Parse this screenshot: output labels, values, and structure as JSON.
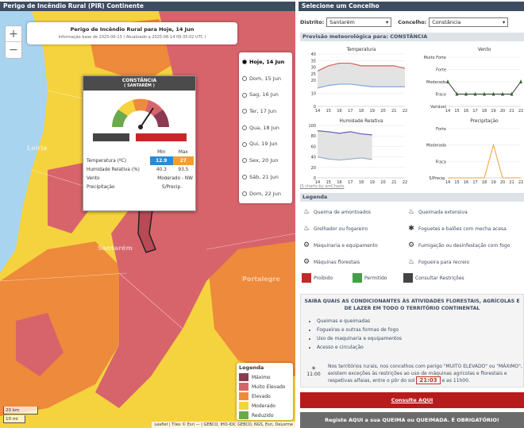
{
  "map_header": "Perigo de Incêndio Rural (PIR) Continente",
  "right_header": "Selecione um Concelho",
  "map": {
    "zoom_in": "+",
    "zoom_out": "−",
    "title": "Perigo de Incêndio Rural para Hoje, 14 Jun",
    "subtitle": "Informação base de 2025-06-13 ( Atualizado a 2025-06-14 09:35:02 UTC )",
    "place_labels": [
      "Leiria",
      "Santarém",
      "Portalegre"
    ],
    "days": [
      {
        "label": "Hoje, 14 Jun",
        "selected": true
      },
      {
        "label": "Dom, 15 Jun",
        "selected": false
      },
      {
        "label": "Sag, 16 Jun",
        "selected": false
      },
      {
        "label": "Ter, 17 Jun",
        "selected": false
      },
      {
        "label": "Qua, 18 Jun",
        "selected": false
      },
      {
        "label": "Qui, 19 Jun",
        "selected": false
      },
      {
        "label": "Sex, 20 Jun",
        "selected": false
      },
      {
        "label": "Sáb, 21 Jun",
        "selected": false
      },
      {
        "label": "Dom, 22 Jun",
        "selected": false
      }
    ],
    "legend_title": "Legenda",
    "legend": [
      {
        "label": "Máximo",
        "color": "#8b3a52"
      },
      {
        "label": "Muito Elevado",
        "color": "#d8646b"
      },
      {
        "label": "Elevado",
        "color": "#ee8a3c"
      },
      {
        "label": "Moderado",
        "color": "#f5d33e"
      },
      {
        "label": "Reduzido",
        "color": "#6aaa4c"
      }
    ],
    "scale_km": "20 km",
    "scale_mi": "10 mi",
    "attribution": "Leaflet | Tiles © Esri — | GEBCO, IHO-IOC GEBCO, NGS, Esri, DeLorme"
  },
  "popup": {
    "name": "CONSTÂNCIA",
    "district": "( SANTARÉM )",
    "col_min": "Min",
    "col_max": "Max",
    "temp_label": "Temperatura (ºC)",
    "temp_min": "12.9",
    "temp_max": "27",
    "hum_label": "Humidade Relativa (%)",
    "hum_min": "40.3",
    "hum_max": "93.5",
    "wind_label": "Vento",
    "wind_value": "Moderado - NW",
    "precip_label": "Precipitação",
    "precip_value": "S/Precip."
  },
  "selectors": {
    "district_label": "Distrito:",
    "district_value": "Santarém",
    "council_label": "Concelho:",
    "council_value": "Constância"
  },
  "forecast_title": "Previsão meteorológica para: CONSTÂNCIA",
  "charts_credit": "JS charts by amCharts",
  "chart_data": [
    {
      "type": "area",
      "title": "Temperatura",
      "x": [
        14,
        15,
        16,
        17,
        18,
        19,
        20,
        21,
        22
      ],
      "ylim": [
        0,
        40
      ],
      "yticks": [
        0,
        10,
        20,
        25,
        30,
        35,
        40
      ],
      "series": [
        {
          "values": [
            27,
            31,
            33,
            33,
            31,
            31,
            31,
            31,
            29
          ],
          "color": "#e05a5a"
        },
        {
          "values": [
            14,
            16,
            17,
            17,
            16,
            15,
            15,
            15,
            15
          ],
          "color": "#7aa7e0"
        }
      ]
    },
    {
      "type": "line",
      "title": "Vento",
      "x": [
        14,
        15,
        16,
        17,
        18,
        19,
        20,
        21,
        22
      ],
      "ycats": [
        "Variável",
        "Fraco",
        "Moderado",
        "Forte",
        "Muito Forte"
      ],
      "values": [
        2,
        1,
        1,
        1,
        1,
        1,
        1,
        1,
        2
      ]
    },
    {
      "type": "area",
      "title": "Humidade Relativa",
      "x": [
        14,
        15,
        16,
        17,
        18,
        19
      ],
      "ylim": [
        0,
        100
      ],
      "yticks": [
        0,
        20,
        40,
        60,
        80,
        100
      ],
      "series": [
        {
          "values": [
            90,
            88,
            85,
            88,
            84,
            82
          ],
          "color": "#6060c0"
        },
        {
          "values": [
            40,
            36,
            34,
            36,
            38,
            35
          ],
          "color": "#9ab0d0"
        }
      ]
    },
    {
      "type": "line",
      "title": "Precipitação",
      "x": [
        14,
        15,
        16,
        17,
        18,
        19,
        20,
        21,
        22
      ],
      "ycats": [
        "S/Precip.",
        "Fraca",
        "Moderada",
        "Forte"
      ],
      "values": [
        0,
        0,
        0,
        0,
        0,
        2,
        0,
        0,
        0
      ]
    }
  ],
  "legend_title": "Legenda",
  "legend_items": [
    {
      "icon": "♨",
      "label": "Queima de amontoados"
    },
    {
      "icon": "♨",
      "label": "Queimada extensiva"
    },
    {
      "icon": "♨",
      "label": "Grelhador ou fogareiro"
    },
    {
      "icon": "✱",
      "label": "Foguetes e balões com mecha acesa"
    },
    {
      "icon": "⚙",
      "label": "Maquinaria e equipamento"
    },
    {
      "icon": "⚙",
      "label": "Fumigação ou desinfestação com fogo"
    },
    {
      "icon": "⚙",
      "label": "Máquinas florestais"
    },
    {
      "icon": "♨",
      "label": "Fogueira para recreio"
    }
  ],
  "status_items": [
    {
      "label": "Proibido",
      "color": "#c62828"
    },
    {
      "label": "Permitido",
      "color": "#43a047"
    },
    {
      "label": "Consultar Restrições",
      "color": "#444444"
    }
  ],
  "info": {
    "title": "SAIBA QUAIS AS CONDICIONANTES ÀS ATIVIDADES FLORESTAIS, AGRÍCOLAS E DE LAZER EM TODO O TERRITÓRIO CONTINENTAL",
    "bullets": [
      "Queimas e queimadas",
      "Fogueiras e outras formas de fogo",
      "Uso de maquinaria e equipamentos",
      "Acesso e circulação"
    ],
    "sun_time": "11:00",
    "note_a": "Nos territórios rurais, nos concelhos com perigo \"MUITO ELEVADO\" ou \"MÁXIMO\", existem exceções às restrições ao uso de máquinas agrícolas e florestais e respetivas alfaias, entre o pôr do sol",
    "sunset": "21:03",
    "note_b": "e as 11h00."
  },
  "btn_consult": "Consulte AQUI",
  "btn_register": "Registe AQUI a sua QUEIMA ou QUEIMADA. É OBRIGATÓRIO!"
}
